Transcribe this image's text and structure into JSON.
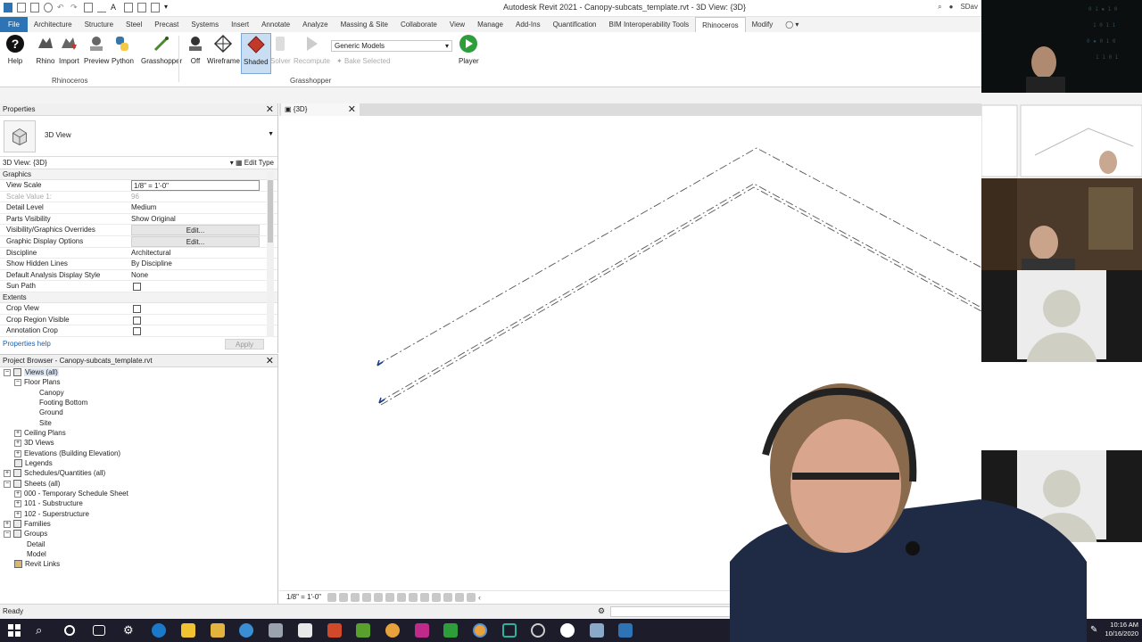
{
  "app": {
    "title": "Autodesk Revit 2021 - Canopy-subcats_template.rvt - 3D View: {3D}",
    "user": "SDav"
  },
  "ribbon": {
    "tabs": [
      "File",
      "Architecture",
      "Structure",
      "Steel",
      "Precast",
      "Systems",
      "Insert",
      "Annotate",
      "Analyze",
      "Massing & Site",
      "Collaborate",
      "View",
      "Manage",
      "Add-Ins",
      "Quantification",
      "BIM Interoperability Tools",
      "Rhinoceros",
      "Modify"
    ],
    "active_tab": "Rhinoceros",
    "buttons": {
      "help": "Help",
      "rhino": "Rhino",
      "import": "Import",
      "preview": "Preview",
      "python": "Python",
      "grasshopper": "Grasshopper",
      "off": "Off",
      "wireframe": "Wireframe",
      "shaded": "Shaded",
      "solver": "Solver",
      "recompute": "Recompute",
      "player": "Player",
      "bake_selected": "Bake Selected"
    },
    "category_select": "Generic Models",
    "panels": {
      "rhinoceros": "Rhinoceros",
      "grasshopper": "Grasshopper"
    }
  },
  "properties": {
    "title": "Properties",
    "type_name": "3D View",
    "instance": "3D View: {3D}",
    "edit_type": "Edit Type",
    "groups": {
      "graphics": "Graphics",
      "extents": "Extents"
    },
    "rows": {
      "view_scale": {
        "label": "View Scale",
        "value": "1/8\" = 1'-0\""
      },
      "scale_value": {
        "label": "Scale Value    1:",
        "value": "96"
      },
      "detail_level": {
        "label": "Detail Level",
        "value": "Medium"
      },
      "parts_visibility": {
        "label": "Parts Visibility",
        "value": "Show Original"
      },
      "vg_overrides": {
        "label": "Visibility/Graphics Overrides",
        "value": "Edit..."
      },
      "graphic_display": {
        "label": "Graphic Display Options",
        "value": "Edit..."
      },
      "discipline": {
        "label": "Discipline",
        "value": "Architectural"
      },
      "hidden_lines": {
        "label": "Show Hidden Lines",
        "value": "By Discipline"
      },
      "analysis_style": {
        "label": "Default Analysis Display Style",
        "value": "None"
      },
      "sun_path": {
        "label": "Sun Path",
        "checked": false
      },
      "crop_view": {
        "label": "Crop View",
        "checked": false
      },
      "crop_region_visible": {
        "label": "Crop Region Visible",
        "checked": false
      },
      "annotation_crop": {
        "label": "Annotation Crop",
        "checked": false
      }
    },
    "help_link": "Properties help",
    "apply": "Apply"
  },
  "browser": {
    "title": "Project Browser - Canopy-subcats_template.rvt",
    "nodes": {
      "views_all": "Views (all)",
      "floor_plans": "Floor Plans",
      "canopy": "Canopy",
      "footing_bottom": "Footing Bottom",
      "ground": "Ground",
      "site": "Site",
      "ceiling_plans": "Ceiling Plans",
      "views_3d": "3D Views",
      "elevations": "Elevations (Building Elevation)",
      "legends": "Legends",
      "schedules": "Schedules/Quantities (all)",
      "sheets": "Sheets (all)",
      "sheet_000": "000 - Temporary Schedule Sheet",
      "sheet_101": "101 - Substructure",
      "sheet_102": "102 - Superstructure",
      "families": "Families",
      "groups": "Groups",
      "detail": "Detail",
      "model": "Model",
      "revit_links": "Revit Links"
    }
  },
  "view": {
    "tab": "{3D}",
    "scale": "1/8\" = 1'-0\""
  },
  "status": {
    "text": "Ready"
  },
  "taskbar": {
    "time": "10:16 AM",
    "date": "10/16/2020"
  },
  "colors": {
    "file_tab": "#2e74b5",
    "selected_tool": "#c9ddf3",
    "taskbar": "#1c1c2a",
    "link": "#1a5fb4"
  }
}
